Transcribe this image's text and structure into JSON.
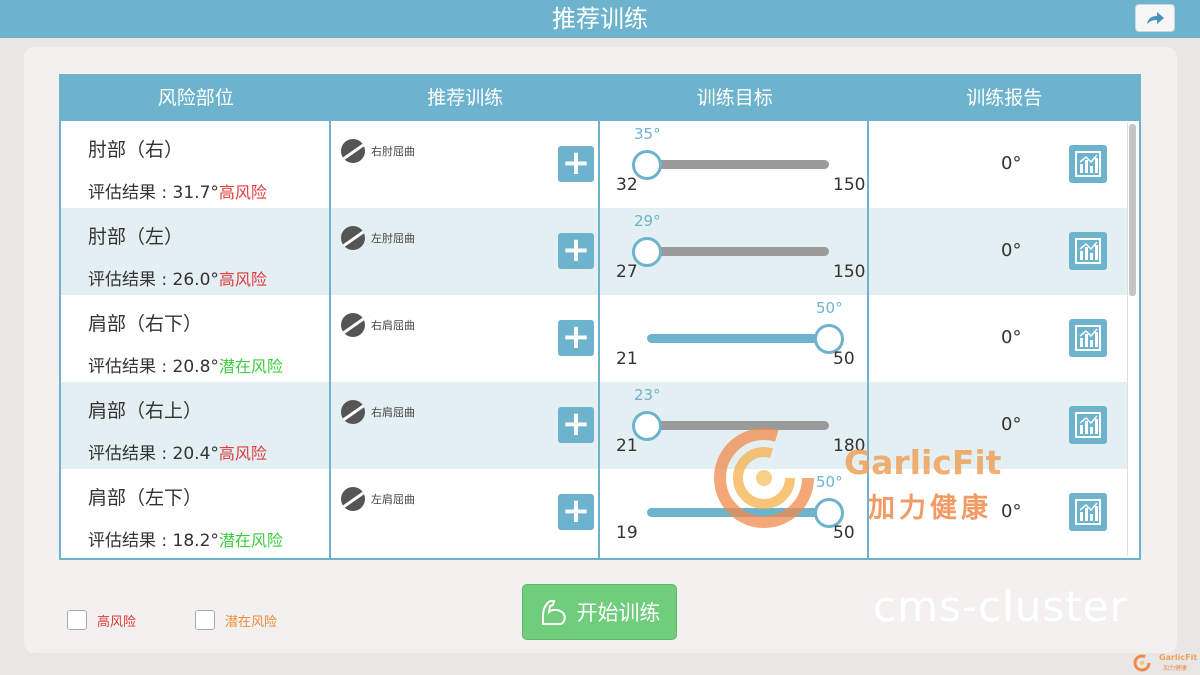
{
  "header": {
    "title": "推荐训练",
    "share_icon": "share-arrow-icon"
  },
  "table": {
    "columns": [
      "风险部位",
      "推荐训练",
      "训练目标",
      "训练报告"
    ],
    "rows": [
      {
        "part": "肘部（右）",
        "result_prefix": "评估结果 : ",
        "result_value": "31.7°",
        "risk": "高风险",
        "risk_color": "#e03b3b",
        "exercise": "右肘屈曲",
        "target_label": "35°",
        "min": "32",
        "max": "150",
        "slider_fraction": 0.0,
        "slider_style": "gray",
        "report": "0°"
      },
      {
        "part": "肘部（左）",
        "result_prefix": "评估结果 : ",
        "result_value": "26.0°",
        "risk": "高风险",
        "risk_color": "#e03b3b",
        "exercise": "左肘屈曲",
        "target_label": "29°",
        "min": "27",
        "max": "150",
        "slider_fraction": 0.0,
        "slider_style": "gray",
        "report": "0°"
      },
      {
        "part": "肩部（右下）",
        "result_prefix": "评估结果 : ",
        "result_value": "20.8°",
        "risk": "潜在风险",
        "risk_color": "#3dcc3d",
        "exercise": "右肩屈曲",
        "target_label": "50°",
        "min": "21",
        "max": "50",
        "slider_fraction": 1.0,
        "slider_style": "blue",
        "report": "0°"
      },
      {
        "part": "肩部（右上）",
        "result_prefix": "评估结果 : ",
        "result_value": "20.4°",
        "risk": "高风险",
        "risk_color": "#e03b3b",
        "exercise": "右肩屈曲",
        "target_label": "23°",
        "min": "21",
        "max": "180",
        "slider_fraction": 0.0,
        "slider_style": "gray",
        "report": "0°"
      },
      {
        "part": "肩部（左下）",
        "result_prefix": "评估结果 : ",
        "result_value": "18.2°",
        "risk": "潜在风险",
        "risk_color": "#3dcc3d",
        "exercise": "左肩屈曲",
        "target_label": "50°",
        "min": "19",
        "max": "50",
        "slider_fraction": 1.0,
        "slider_style": "blue",
        "report": "0°"
      }
    ]
  },
  "legend": {
    "high_risk": {
      "label": "高风险",
      "color": "#e03b3b"
    },
    "potential_risk": {
      "label": "潜在风险",
      "color": "#f08a3a"
    }
  },
  "start_button": {
    "label": "开始训练",
    "icon": "bicep-icon"
  },
  "watermark": {
    "text": "cms-cluster"
  },
  "logo": {
    "en": "GarlicFit",
    "cn": "加力健康"
  },
  "colors": {
    "accent": "#6eb3cd",
    "start_green": "#6fcd7b"
  }
}
